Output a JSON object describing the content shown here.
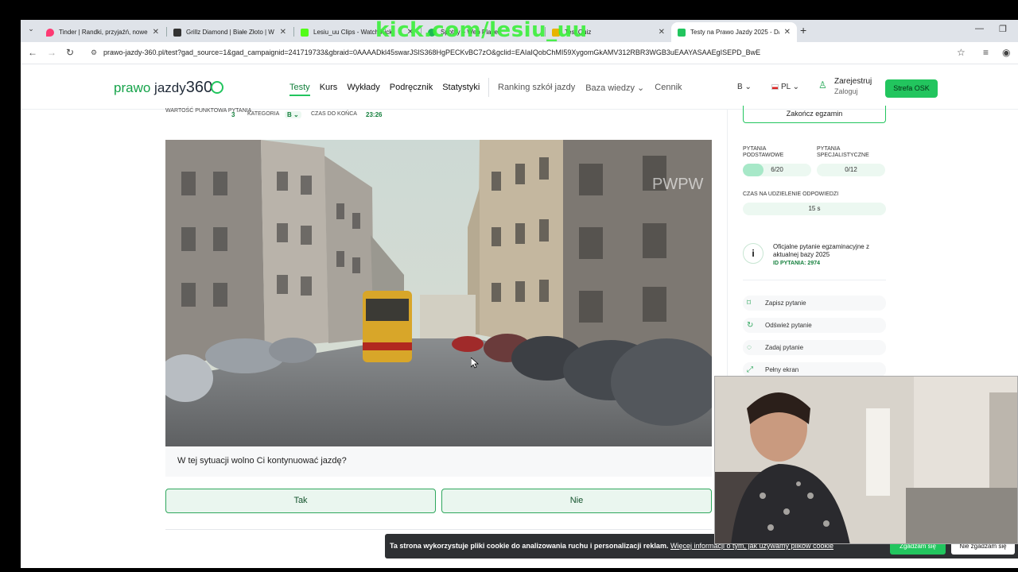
{
  "browser": {
    "tabs": [
      {
        "title": "Tinder | Randki, przyjaźń, nowe",
        "favicon_color": "#fd3a73",
        "active": false
      },
      {
        "title": "Grillz Diamond | Białe Złoto | W",
        "favicon_color": "#333333",
        "active": false
      },
      {
        "title": "Lesiu_uu Clips - Watch Kick",
        "favicon_color": "#53fc18",
        "active": false
      },
      {
        "title": "Spotify – Web Player",
        "favicon_color": "#1db954",
        "active": false
      },
      {
        "title": "Test Quiz",
        "favicon_color": "#e8b400",
        "active": false
      },
      {
        "title": "Testy na Prawo Jazdy 2025 - Da",
        "favicon_color": "#22c55e",
        "active": true
      }
    ],
    "overlay_watermark": "kick.com/lesiu_uu",
    "url": "prawo-jazdy-360.pl/test?gad_source=1&gad_campaignid=241719733&gbraid=0AAAADkl45swarJSlS368HgPECKvBC7zO&gclid=EAIaIQobChMI59XygomGkAMV312RBR3WGB3uEAAYASAAEgISEPD_BwE"
  },
  "site": {
    "logo": {
      "word1": "prawo",
      "word2": "jazdy",
      "word3": "360"
    },
    "nav": [
      "Testy",
      "Kurs",
      "Wykłady",
      "Podręcznik",
      "Statystyki"
    ],
    "nav_active": "Testy",
    "subnav": [
      "Ranking szkół jazdy",
      "Baza wiedzy",
      "Cennik"
    ],
    "category_selector": "B",
    "language": "PL",
    "account": {
      "register": "Zarejestruj",
      "login": "Zaloguj"
    },
    "osk_button": "Strefa OSK",
    "accent_color": "#22c55e"
  },
  "exam": {
    "points_label": "Wartość punktowa pytania",
    "points_value": "3",
    "category_label": "Kategoria",
    "category_value": "B",
    "time_label": "Czas do końca",
    "time_value": "23:26",
    "end_button": "Zakończ egzamin",
    "question": "W tej sytuacji wolno Ci kontynuować jazdę?",
    "answers": [
      "Tak",
      "Nie"
    ],
    "video_watermark": "PWPW"
  },
  "sidebar": {
    "basic_label": "Pytania podstawowe",
    "basic_value": "6/20",
    "basic_progress": 0.3,
    "special_label": "Pytania specjalistyczne",
    "special_value": "0/12",
    "answer_time_label": "Czas na udzielenie odpowiedzi",
    "answer_time_value": "15 s",
    "info_text": "Oficjalne pytanie egzaminacyjne z aktualnej bazy 2025",
    "question_id": "ID PYTANIA: 2974",
    "actions": [
      {
        "label": "Zapisz pytanie",
        "icon": "bookmark-icon"
      },
      {
        "label": "Odśwież pytanie",
        "icon": "refresh-icon"
      },
      {
        "label": "Zadaj pytanie",
        "icon": "chat-icon"
      },
      {
        "label": "Pełny ekran",
        "icon": "fullscreen-icon"
      }
    ]
  },
  "cookie_banner": {
    "text": "Ta strona wykorzystuje pliki cookie do analizowania ruchu i personalizacji reklam.",
    "link": "Więcej informacji o tym, jak używamy plików cookie",
    "accept": "Zgadzam się",
    "reject": "Nie zgadzam się"
  }
}
